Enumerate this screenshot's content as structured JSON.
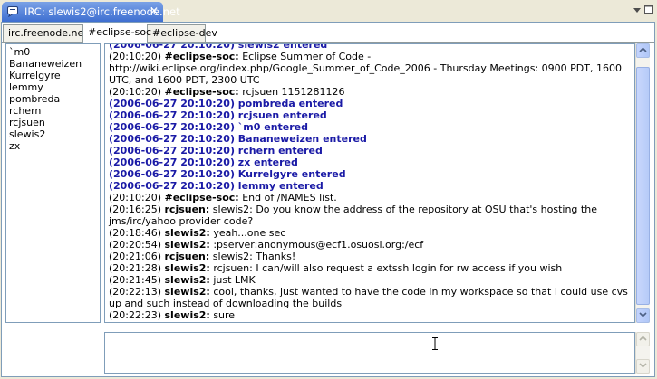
{
  "view": {
    "tab_title": "IRC: slewis2@irc.freenode.net",
    "close_glyph": "✕"
  },
  "channel_tabs": [
    {
      "label": "irc.freenode.net"
    },
    {
      "label": "#eclipse-soc",
      "active": true
    },
    {
      "label": "#eclipse-dev"
    }
  ],
  "users": [
    "`m0",
    "Bananeweizen",
    "Kurrelgyre",
    "lemmy",
    "pombreda",
    "rchern",
    "rcjsuen",
    "slewis2",
    "zx"
  ],
  "messages": [
    {
      "kind": "sys",
      "text": "(2006-06-27 20:10:20) slewis2 entered"
    },
    {
      "kind": "msg",
      "time": "(20:10:20)",
      "nick": "#eclipse-soc:",
      "text": "Eclipse Summer of Code - http://wiki.eclipse.org/index.php/Google_Summer_of_Code_2006 - Thursday Meetings: 0900 PDT, 1600 UTC, and 1600 PDT, 2300 UTC"
    },
    {
      "kind": "msg",
      "time": "(20:10:20)",
      "nick": "#eclipse-soc:",
      "text": "rcjsuen 1151281126"
    },
    {
      "kind": "sys",
      "text": "(2006-06-27 20:10:20) pombreda entered"
    },
    {
      "kind": "sys",
      "text": "(2006-06-27 20:10:20) rcjsuen entered"
    },
    {
      "kind": "sys",
      "text": "(2006-06-27 20:10:20) `m0 entered"
    },
    {
      "kind": "sys",
      "text": "(2006-06-27 20:10:20) Bananeweizen entered"
    },
    {
      "kind": "sys",
      "text": "(2006-06-27 20:10:20) rchern entered"
    },
    {
      "kind": "sys",
      "text": "(2006-06-27 20:10:20) zx entered"
    },
    {
      "kind": "sys",
      "text": "(2006-06-27 20:10:20) Kurrelgyre entered"
    },
    {
      "kind": "sys",
      "text": "(2006-06-27 20:10:20) lemmy entered"
    },
    {
      "kind": "msg",
      "time": "(20:10:20)",
      "nick": "#eclipse-soc:",
      "text": "End of /NAMES list."
    },
    {
      "kind": "msg",
      "time": "(20:16:25)",
      "nick": "rcjsuen:",
      "text": "slewis2: Do you know the address of the repository at OSU that's hosting the jms/irc/yahoo provider code?"
    },
    {
      "kind": "msg",
      "time": "(20:18:46)",
      "nick": "slewis2:",
      "text": "yeah...one sec"
    },
    {
      "kind": "msg",
      "time": "(20:20:54)",
      "nick": "slewis2:",
      "text": ":pserver:anonymous@ecf1.osuosl.org:/ecf"
    },
    {
      "kind": "msg",
      "time": "(20:21:06)",
      "nick": "rcjsuen:",
      "text": "slewis2: Thanks!"
    },
    {
      "kind": "msg",
      "time": "(20:21:28)",
      "nick": "slewis2:",
      "text": "rcjsuen: I can/will also request a extssh login for rw access if you wish"
    },
    {
      "kind": "msg",
      "time": "(20:21:45)",
      "nick": "slewis2:",
      "text": "just LMK"
    },
    {
      "kind": "msg",
      "time": "(20:22:13)",
      "nick": "slewis2:",
      "text": "cool, thanks, just wanted to have the code in my workspace so that i could use cvs up and such instead of downloading the builds"
    },
    {
      "kind": "msg",
      "time": "(20:22:23)",
      "nick": "slewis2:",
      "text": "sure"
    }
  ],
  "input": {
    "value": ""
  },
  "colors": {
    "system_message": "#1a1aa6",
    "tab_active": "#3e6fd1"
  }
}
